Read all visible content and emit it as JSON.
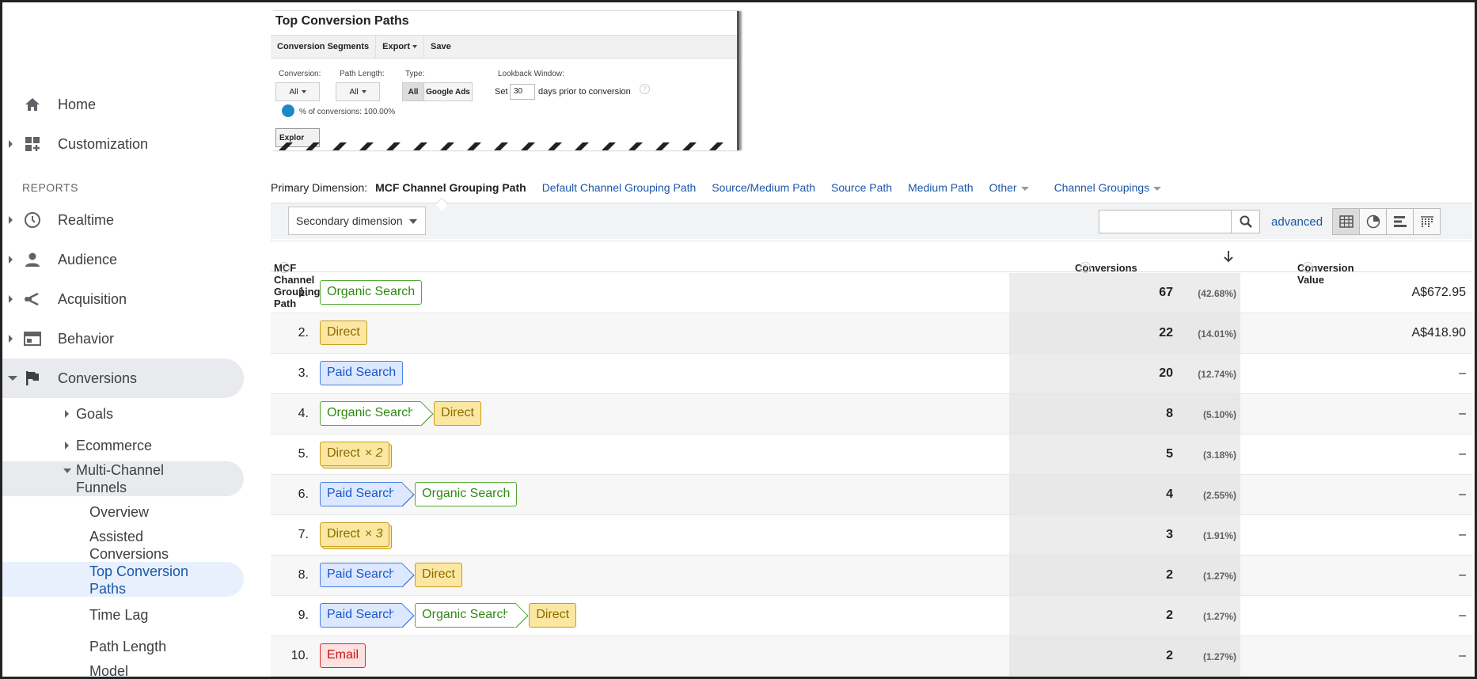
{
  "sidebar": {
    "home": "Home",
    "customization": "Customization",
    "reports_label": "REPORTS",
    "realtime": "Realtime",
    "audience": "Audience",
    "acquisition": "Acquisition",
    "behavior": "Behavior",
    "conversions": "Conversions",
    "goals": "Goals",
    "ecommerce": "Ecommerce",
    "mcf_line1": "Multi-Channel",
    "mcf_line2": "Funnels",
    "overview": "Overview",
    "assisted_line1": "Assisted",
    "assisted_line2": "Conversions",
    "top_paths_line1": "Top Conversion",
    "top_paths_line2": "Paths",
    "time_lag": "Time Lag",
    "path_length": "Path Length",
    "model_partial": "Model"
  },
  "inset": {
    "title": "Top Conversion Paths",
    "toolbar": [
      "Conversion Segments",
      "Export",
      "Save"
    ],
    "conversion_label": "Conversion:",
    "conversion_value": "All",
    "path_length_label": "Path Length:",
    "path_length_value": "All",
    "type_label": "Type:",
    "type_all": "All",
    "type_ads": "Google Ads",
    "lookback_label": "Lookback Window:",
    "set_label": "Set",
    "days_value": "30",
    "days_suffix": "days prior to conversion",
    "pct_conversions": "% of conversions: 100.00%",
    "explore_partial": "Explor"
  },
  "dimensions": {
    "label": "Primary Dimension:",
    "current": "MCF Channel Grouping Path",
    "links": [
      "Default Channel Grouping Path",
      "Source/Medium Path",
      "Source Path",
      "Medium Path",
      "Other"
    ],
    "channel_groupings": "Channel Groupings"
  },
  "toolbar": {
    "secondary_dimension": "Secondary dimension",
    "advanced": "advanced"
  },
  "table": {
    "headers": {
      "path": "MCF Channel Grouping Path",
      "conversions": "Conversions",
      "value": "Conversion Value"
    },
    "rows": [
      {
        "num": "1.",
        "conv": "67",
        "pct": "(42.68%)",
        "value": "A$672.95"
      },
      {
        "num": "2.",
        "conv": "22",
        "pct": "(14.01%)",
        "value": "A$418.90"
      },
      {
        "num": "3.",
        "conv": "20",
        "pct": "(12.74%)",
        "value": "–"
      },
      {
        "num": "4.",
        "conv": "8",
        "pct": "(5.10%)",
        "value": "–"
      },
      {
        "num": "5.",
        "conv": "5",
        "pct": "(3.18%)",
        "value": "–"
      },
      {
        "num": "6.",
        "conv": "4",
        "pct": "(2.55%)",
        "value": "–"
      },
      {
        "num": "7.",
        "conv": "3",
        "pct": "(1.91%)",
        "value": "–"
      },
      {
        "num": "8.",
        "conv": "2",
        "pct": "(1.27%)",
        "value": "–"
      },
      {
        "num": "9.",
        "conv": "2",
        "pct": "(1.27%)",
        "value": "–"
      },
      {
        "num": "10.",
        "conv": "2",
        "pct": "(1.27%)",
        "value": "–"
      }
    ],
    "channels": {
      "organic": "Organic Search",
      "direct": "Direct",
      "paid": "Paid Search",
      "email": "Email",
      "x2": "× 2",
      "x3": "× 3"
    }
  },
  "colors": {
    "organic": "#56a834",
    "direct": "#c79c1c",
    "paid": "#4b7fe0",
    "email": "#d32f2f",
    "link": "#1a57a8"
  }
}
